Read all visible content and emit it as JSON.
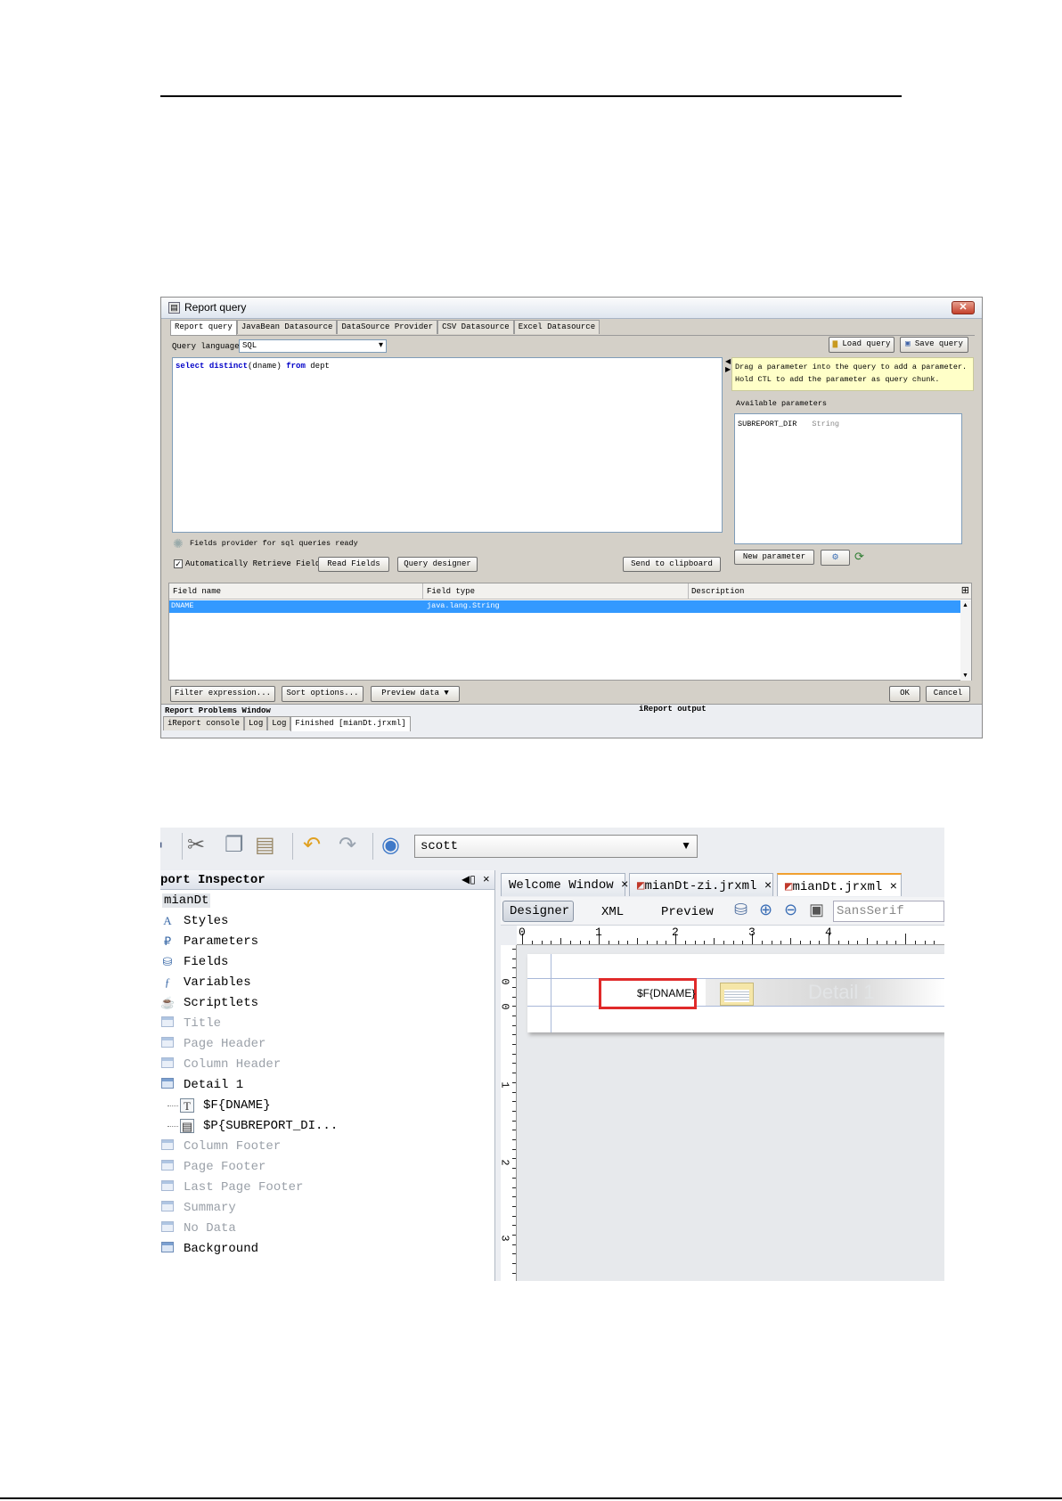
{
  "report_query": {
    "window_title": "Report query",
    "tabs": [
      "Report query",
      "JavaBean Datasource",
      "DataSource Provider",
      "CSV Datasource",
      "Excel Datasource"
    ],
    "query_language_label": "Query language",
    "query_language_value": "SQL",
    "load_query": "Load query",
    "save_query": "Save query",
    "sql": {
      "kw1": "select",
      "fn": "distinct",
      "arg": "(dname)",
      "kw2": "from",
      "table": "dept"
    },
    "hint_line1": "Drag a parameter into the query to add a parameter.",
    "hint_line2": "Hold CTL to add the parameter as query chunk.",
    "available_parameters_label": "Available parameters",
    "parameters": [
      {
        "name": "SUBREPORT_DIR",
        "type": "String"
      }
    ],
    "status": "Fields provider for sql queries ready",
    "auto_retrieve_label": "Automatically Retrieve Fields",
    "read_fields": "Read Fields",
    "query_designer": "Query designer",
    "send_to_clipboard": "Send to clipboard",
    "new_parameter": "New parameter",
    "columns": [
      "Field name",
      "Field type",
      "Description"
    ],
    "rows": [
      {
        "name": "DNAME",
        "type": "java.lang.String",
        "description": ""
      }
    ],
    "filter_expression": "Filter expression...",
    "sort_options": "Sort options...",
    "preview_data": "Preview data",
    "ok": "OK",
    "cancel": "Cancel",
    "problems_window": "Report Problems Window",
    "ireport_output": "iReport output",
    "bottom_tabs": [
      "iReport console",
      "Log",
      "Log",
      "Finished [mianDt.jrxml]"
    ]
  },
  "designer": {
    "connection": "scott",
    "inspector_title": "port Inspector",
    "root": "mianDt",
    "tree": [
      {
        "label": "Styles",
        "icon": "styles-icon",
        "dim": false,
        "indent": 0
      },
      {
        "label": "Parameters",
        "icon": "parameters-icon",
        "dim": false,
        "indent": 0
      },
      {
        "label": "Fields",
        "icon": "fields-icon",
        "dim": false,
        "indent": 0
      },
      {
        "label": "Variables",
        "icon": "variables-icon",
        "dim": false,
        "indent": 0
      },
      {
        "label": "Scriptlets",
        "icon": "scriptlets-icon",
        "dim": false,
        "indent": 0
      },
      {
        "label": "Title",
        "icon": "band-icon",
        "dim": true,
        "indent": 0
      },
      {
        "label": "Page Header",
        "icon": "band-icon",
        "dim": true,
        "indent": 0
      },
      {
        "label": "Column Header",
        "icon": "band-icon",
        "dim": true,
        "indent": 0
      },
      {
        "label": "Detail 1",
        "icon": "band-icon",
        "dim": false,
        "indent": 0
      },
      {
        "label": "$F{DNAME}",
        "icon": "textfield-icon",
        "dim": false,
        "indent": 1
      },
      {
        "label": "$P{SUBREPORT_DI...",
        "icon": "subreport-icon",
        "dim": false,
        "indent": 1
      },
      {
        "label": "Column Footer",
        "icon": "band-icon",
        "dim": true,
        "indent": 0
      },
      {
        "label": "Page Footer",
        "icon": "band-icon",
        "dim": true,
        "indent": 0
      },
      {
        "label": "Last Page Footer",
        "icon": "band-icon",
        "dim": true,
        "indent": 0
      },
      {
        "label": "Summary",
        "icon": "band-icon",
        "dim": true,
        "indent": 0
      },
      {
        "label": "No Data",
        "icon": "band-icon",
        "dim": true,
        "indent": 0
      },
      {
        "label": "Background",
        "icon": "band-icon",
        "dim": false,
        "indent": 0
      }
    ],
    "doc_tabs": [
      "Welcome Window",
      "mianDt-zi.jrxml",
      "mianDt.jrxml"
    ],
    "view_tabs": [
      "Designer",
      "XML",
      "Preview"
    ],
    "font": "SansSerif",
    "ruler_h": [
      "0",
      "1",
      "2",
      "3",
      "4"
    ],
    "ruler_v": [
      "0",
      "0",
      "1",
      "2",
      "3"
    ],
    "field_text": "$F{DNAME}",
    "band_label": "Detail 1"
  }
}
